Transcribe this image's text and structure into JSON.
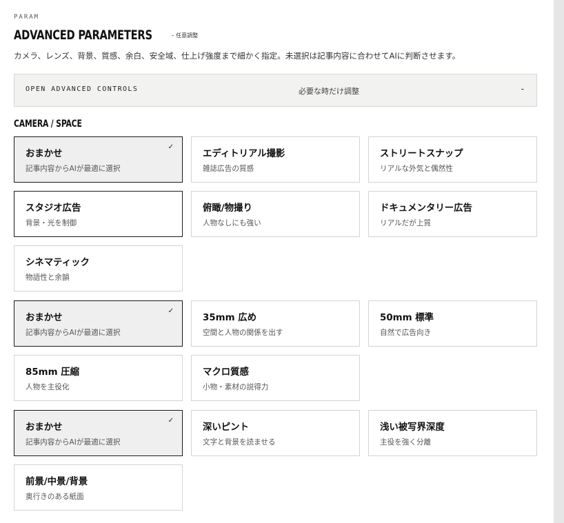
{
  "header": {
    "kicker": "PARAM",
    "title": "ADVANCED PARAMETERS",
    "subtitle": "– 任意調整",
    "description": "カメラ、レンズ、背景、質感、余白、安全域、仕上げ強度まで細かく指定。未選択は記事内容に合わせてAIに判断させます。"
  },
  "advanced_bar": {
    "label": "OPEN ADVANCED CONTROLS",
    "hint": "必要な時だけ調整",
    "toggle": "-"
  },
  "section": {
    "title": "CAMERA / SPACE"
  },
  "check_glyph": "✓",
  "groups": [
    {
      "options": [
        {
          "name": "おまかせ",
          "sub": "記事内容からAIが最適に選択",
          "selected": true
        },
        {
          "name": "エディトリアル撮影",
          "sub": "雑誌広告の質感"
        },
        {
          "name": "ストリートスナップ",
          "sub": "リアルな外気と偶然性"
        },
        {
          "name": "スタジオ広告",
          "sub": "背景・光を制御",
          "outlined": true
        },
        {
          "name": "俯瞰/物撮り",
          "sub": "人物なしにも強い"
        },
        {
          "name": "ドキュメンタリー広告",
          "sub": "リアルだが上質"
        },
        {
          "name": "シネマティック",
          "sub": "物語性と余韻"
        }
      ]
    },
    {
      "options": [
        {
          "name": "おまかせ",
          "sub": "記事内容からAIが最適に選択",
          "selected": true
        },
        {
          "name": "35mm 広め",
          "sub": "空間と人物の関係を出す"
        },
        {
          "name": "50mm 標準",
          "sub": "自然で広告向き"
        },
        {
          "name": "85mm 圧縮",
          "sub": "人物を主役化"
        },
        {
          "name": "マクロ質感",
          "sub": "小物・素材の説得力"
        }
      ]
    },
    {
      "options": [
        {
          "name": "おまかせ",
          "sub": "記事内容からAIが最適に選択",
          "selected": true
        },
        {
          "name": "深いピント",
          "sub": "文字と背景を読ませる"
        },
        {
          "name": "浅い被写界深度",
          "sub": "主役を強く分離"
        },
        {
          "name": "前景/中景/背景",
          "sub": "奥行きのある紙面"
        }
      ]
    }
  ]
}
